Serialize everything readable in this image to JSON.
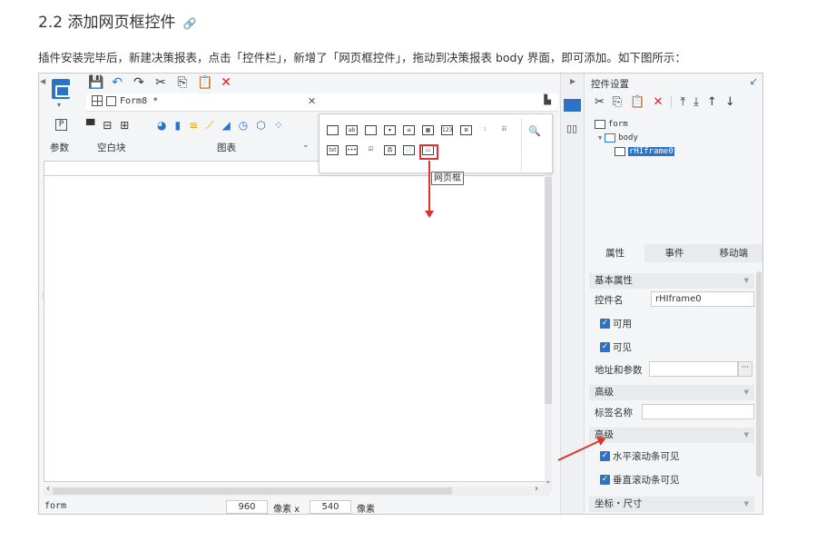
{
  "doc": {
    "title": "2.2 添加网页框控件",
    "paragraph": "插件安装完毕后，新建决策报表，点击「控件栏」，新增了「网页框控件」，拖动到决策报表 body 界面，即可添加。如下图所示："
  },
  "designer": {
    "tab_title": "Form8 *",
    "ribbon": {
      "params_label": "参数",
      "blank_label": "空白块",
      "chart_label": "图表"
    },
    "widget_tooltip": "网页框",
    "status": {
      "form_label": "form",
      "width": "960",
      "unit1": "像素 x",
      "height": "540",
      "unit2": "像素"
    }
  },
  "panel": {
    "title": "控件设置",
    "tree": {
      "root": "form",
      "body": "body",
      "widget": "rHIframe0"
    },
    "tabs": [
      "属性",
      "事件",
      "移动端"
    ],
    "sections": {
      "basic": "基本属性",
      "advanced1": "高级",
      "advanced2": "高级",
      "coords": "坐标・尺寸"
    },
    "fields": {
      "name_label": "控件名",
      "name_value": "rHIframe0",
      "enabled": "可用",
      "visible": "可见",
      "url_label": "地址和参数",
      "tag_label": "标签名称",
      "hscroll": "水平滚动条可见",
      "vscroll": "垂直滚动条可见"
    }
  }
}
